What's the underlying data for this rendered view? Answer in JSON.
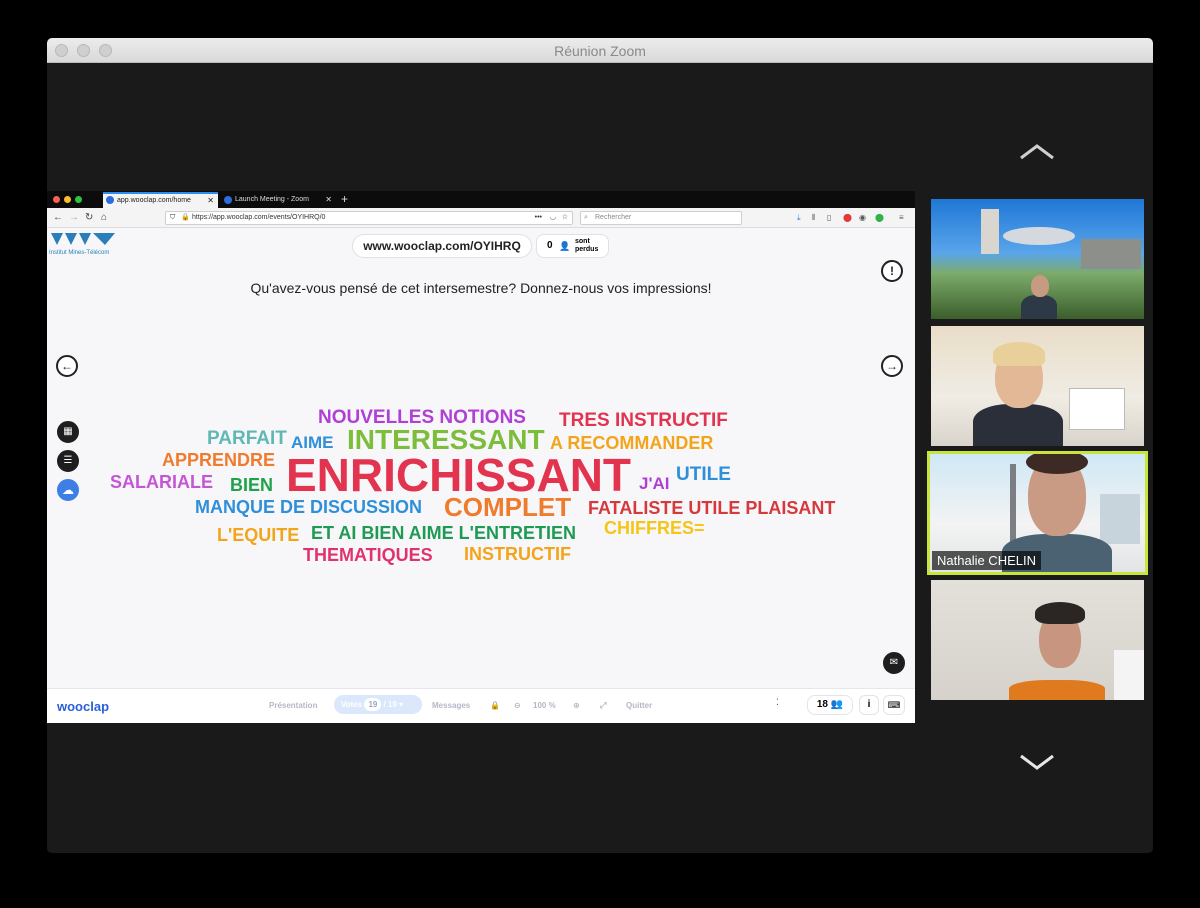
{
  "zoom": {
    "title": "Réunion Zoom"
  },
  "browser": {
    "tabs": [
      {
        "label": "app.wooclap.com/home",
        "active": true
      },
      {
        "label": "Launch Meeting - Zoom",
        "active": false
      }
    ],
    "url": "https://app.wooclap.com/events/OYIHRQ/0",
    "search_placeholder": "Rechercher"
  },
  "wooclap": {
    "logo_org": "Institut Mines-Télécom",
    "event_url": "www.wooclap.com/OYIHRQ",
    "lost_count": "0",
    "lost_label": "sont perdus",
    "question": "Qu'avez-vous pensé de cet intersemestre? Donnez-nous vos impressions!",
    "words": [
      {
        "text": "NOUVELLES NOTIONS",
        "color": "#b13fd6"
      },
      {
        "text": "TRES INSTRUCTIF",
        "color": "#e2334f"
      },
      {
        "text": "PARFAIT",
        "color": "#5fb8b4"
      },
      {
        "text": "AIME",
        "color": "#2f8fd8"
      },
      {
        "text": "INTERESSANT",
        "color": "#7cbd3c"
      },
      {
        "text": "A RECOMMANDER",
        "color": "#f2a51a"
      },
      {
        "text": "APPRENDRE",
        "color": "#ef7b2c"
      },
      {
        "text": "ENRICHISSANT",
        "color": "#e2334f"
      },
      {
        "text": "J'AI",
        "color": "#b13fd6"
      },
      {
        "text": "UTILE",
        "color": "#2f8fd8"
      },
      {
        "text": "SALARIALE",
        "color": "#c456d6"
      },
      {
        "text": "BIEN",
        "color": "#1fa24a"
      },
      {
        "text": "MANQUE DE DISCUSSION",
        "color": "#2f8fd8"
      },
      {
        "text": "COMPLET",
        "color": "#ef7b2c"
      },
      {
        "text": "FATALISTE UTILE PLAISANT",
        "color": "#d6393b"
      },
      {
        "text": "L'EQUITE",
        "color": "#f2a51a"
      },
      {
        "text": "ET AI BIEN AIME L'ENTRETIEN",
        "color": "#1f9a55"
      },
      {
        "text": "CHIFFRES=",
        "color": "#f5c518"
      },
      {
        "text": "THEMATIQUES",
        "color": "#e0336e"
      },
      {
        "text": "INSTRUCTIF",
        "color": "#f2a51a"
      }
    ],
    "bar": {
      "logo": "wooclap",
      "presentation": "Présentation",
      "votes_label": "Votes",
      "votes_current": "19",
      "votes_total": "/ 19",
      "messages": "Messages",
      "zoom": "100 %",
      "quit": "Quitter",
      "participants": "18"
    }
  },
  "participants": [
    {
      "name": ""
    },
    {
      "name": ""
    },
    {
      "name": "Nathalie CHELIN",
      "active_speaker": true
    },
    {
      "name": ""
    }
  ],
  "colors": {
    "active_speaker_border": "#c7e53a",
    "wooclap_blue": "#2b5fd9"
  }
}
